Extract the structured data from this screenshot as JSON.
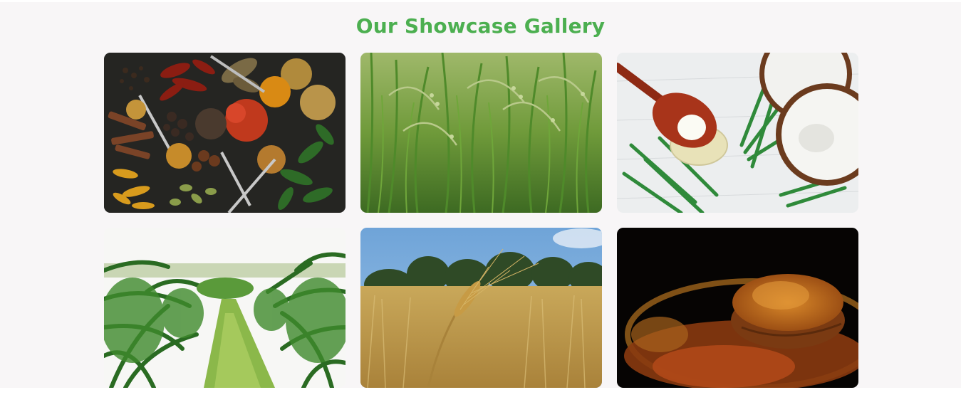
{
  "gallery": {
    "title": "Our Showcase Gallery",
    "images": [
      {
        "subject": "assorted-spices"
      },
      {
        "subject": "rice-paddy-field"
      },
      {
        "subject": "coconut-oil"
      },
      {
        "subject": "dragon-fruit-plantation"
      },
      {
        "subject": "wheat-field"
      },
      {
        "subject": "turmeric-powder"
      }
    ]
  },
  "colors": {
    "title": "#4caf50",
    "background": "#f8f6f7"
  }
}
